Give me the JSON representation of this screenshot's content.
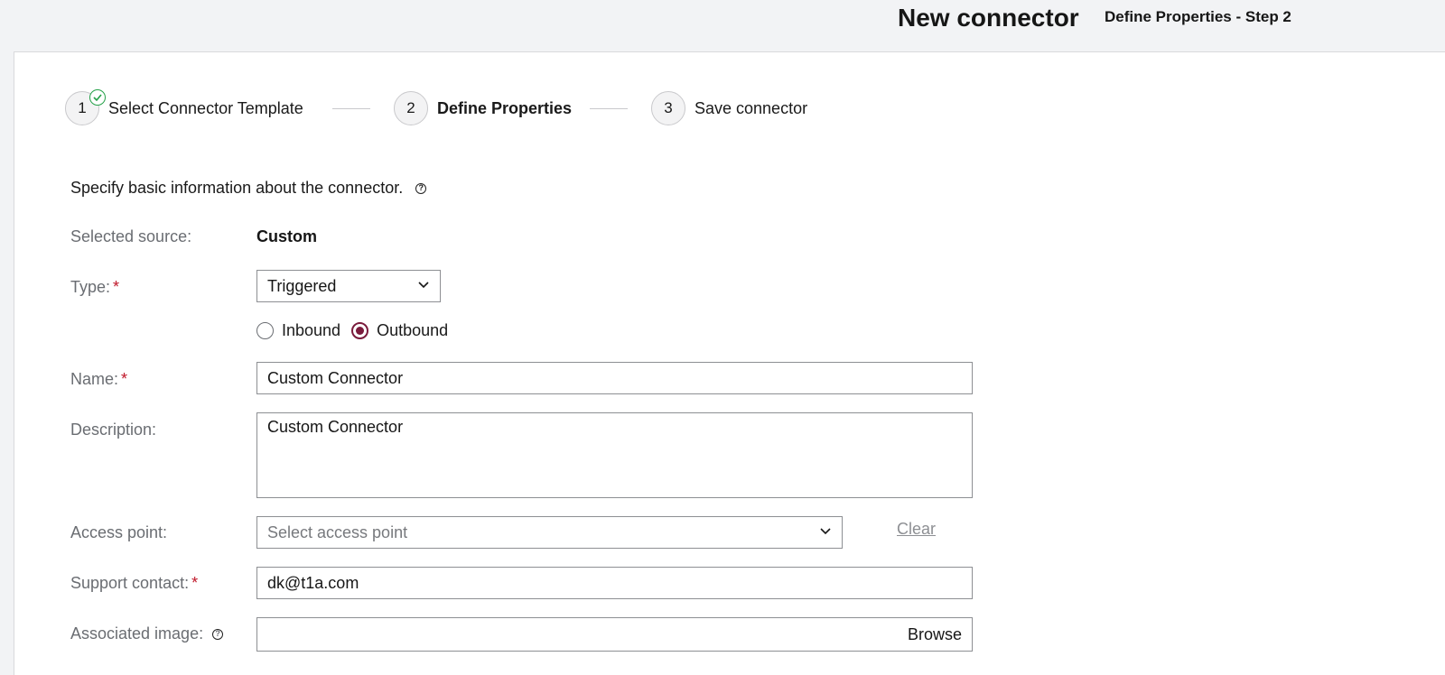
{
  "header": {
    "title": "New connector",
    "subtitle": "Define Properties - Step 2"
  },
  "stepper": {
    "steps": [
      {
        "number": "1",
        "label": "Select Connector Template",
        "state": "completed"
      },
      {
        "number": "2",
        "label": "Define Properties",
        "state": "active"
      },
      {
        "number": "3",
        "label": "Save connector",
        "state": "pending"
      }
    ]
  },
  "form": {
    "intro": "Specify basic information about the connector.",
    "selected_source": {
      "label": "Selected source:",
      "value": "Custom"
    },
    "type": {
      "label": "Type:",
      "required_mark": "*",
      "value": "Triggered"
    },
    "direction": {
      "options": [
        {
          "label": "Inbound",
          "checked": false
        },
        {
          "label": "Outbound",
          "checked": true
        }
      ]
    },
    "name": {
      "label": "Name:",
      "required_mark": "*",
      "value": "Custom Connector"
    },
    "description": {
      "label": "Description:",
      "value": "Custom Connector"
    },
    "access_point": {
      "label": "Access point:",
      "placeholder": "Select access point",
      "clear_label": "Clear"
    },
    "support_contact": {
      "label": "Support contact:",
      "required_mark": "*",
      "value": "dk@t1a.com"
    },
    "associated_image": {
      "label": "Associated image:",
      "browse_label": "Browse"
    }
  },
  "colors": {
    "accent": "#7a1b3c",
    "required": "#c0182a",
    "success": "#24a148"
  }
}
